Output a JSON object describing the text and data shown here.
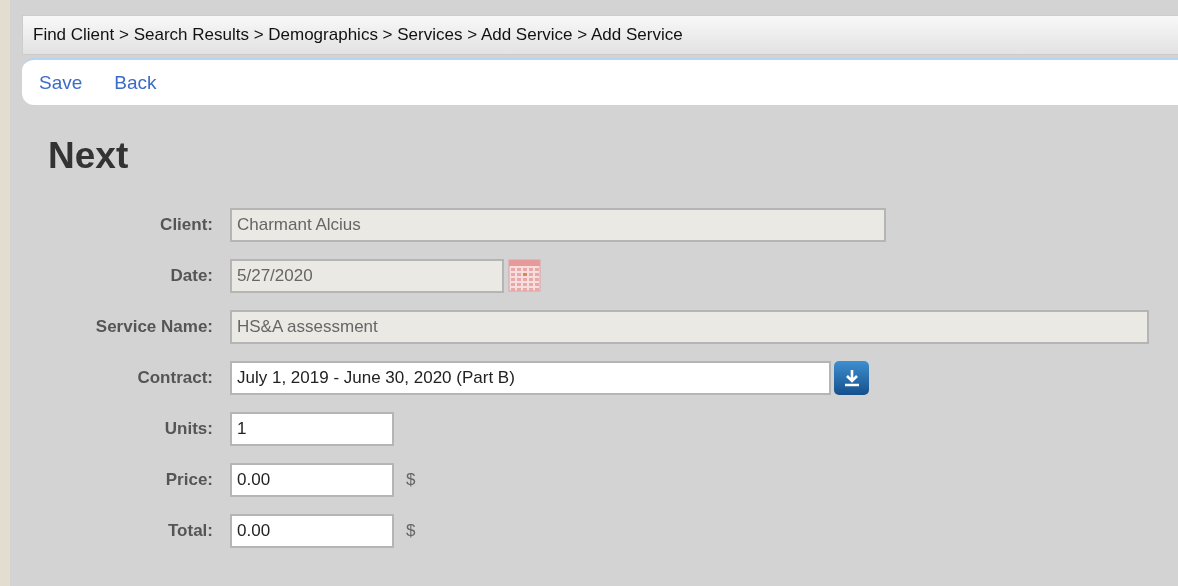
{
  "breadcrumb": "Find Client > Search Results > Demographics > Services > Add Service > Add Service",
  "toolbar": [
    "Save",
    "Back"
  ],
  "heading": "Next",
  "fields": [
    {
      "label": "Client:",
      "value": "Charmant Alcius",
      "disabled": true,
      "kind": "text"
    },
    {
      "label": "Date:",
      "value": "5/27/2020",
      "disabled": true,
      "kind": "date"
    },
    {
      "label": "Service Name:",
      "value": "HS&A assessment",
      "disabled": true,
      "kind": "text"
    },
    {
      "label": "Contract:",
      "value": "July 1, 2019 - June 30, 2020 (Part B)",
      "disabled": false,
      "kind": "select"
    },
    {
      "label": "Units:",
      "value": "1",
      "disabled": false,
      "kind": "number"
    },
    {
      "label": "Price:",
      "value": "0.00",
      "disabled": false,
      "kind": "number",
      "suffix": "$"
    },
    {
      "label": "Total:",
      "value": "0.00",
      "disabled": false,
      "kind": "number",
      "suffix": "$"
    }
  ]
}
